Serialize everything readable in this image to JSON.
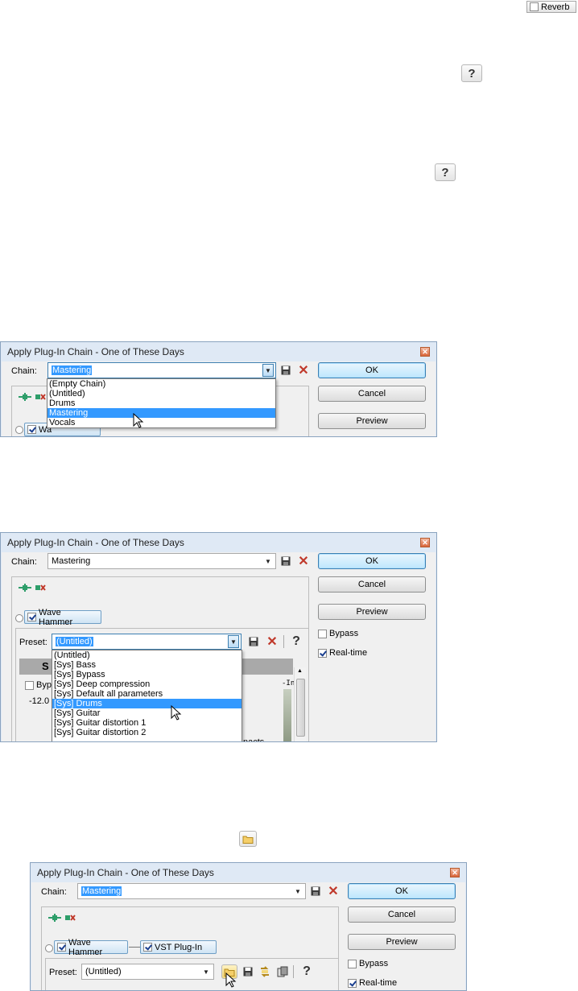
{
  "top_widgets": {
    "reverb_label": "Reverb"
  },
  "dialogs": [
    {
      "title": "Apply Plug-In Chain - One of These Days",
      "chain_label": "Chain:",
      "chain_value": "Mastering",
      "buttons": {
        "ok": "OK",
        "cancel": "Cancel",
        "preview": "Preview"
      },
      "chain_options": [
        "(Empty Chain)",
        "(Untitled)",
        "Drums",
        "Mastering",
        "Vocals"
      ],
      "selected_option": "Mastering",
      "plugin_partial": "Wa"
    },
    {
      "title": "Apply Plug-In Chain - One of These Days",
      "chain_label": "Chain:",
      "chain_value": "Mastering",
      "buttons": {
        "ok": "OK",
        "cancel": "Cancel",
        "preview": "Preview"
      },
      "bypass_label": "Bypass",
      "realtime_label": "Real-time",
      "plugin": "Wave Hammer",
      "preset_label": "Preset:",
      "preset_value": "(Untitled)",
      "preset_options": [
        "(Untitled)",
        "[Sys] Bass",
        "[Sys] Bypass",
        "[Sys] Deep compression",
        "[Sys] Default all parameters",
        "[Sys] Drums",
        "[Sys] Guitar",
        "[Sys] Guitar distortion 1",
        "[Sys] Guitar distortion 2"
      ],
      "selected_preset": "[Sys] Drums",
      "behind_text": {
        "byp": "Byp",
        "value": "-12.0",
        "s": "S",
        "inf": "-Inf",
        "trail": "nacts"
      }
    },
    {
      "title": "Apply Plug-In Chain - One of These Days",
      "chain_label": "Chain:",
      "chain_value": "Mastering",
      "buttons": {
        "ok": "OK",
        "cancel": "Cancel",
        "preview": "Preview"
      },
      "bypass_label": "Bypass",
      "realtime_label": "Real-time",
      "plugins": [
        "Wave Hammer",
        "VST Plug-In"
      ],
      "preset_label": "Preset:",
      "preset_value": "(Untitled)"
    }
  ]
}
